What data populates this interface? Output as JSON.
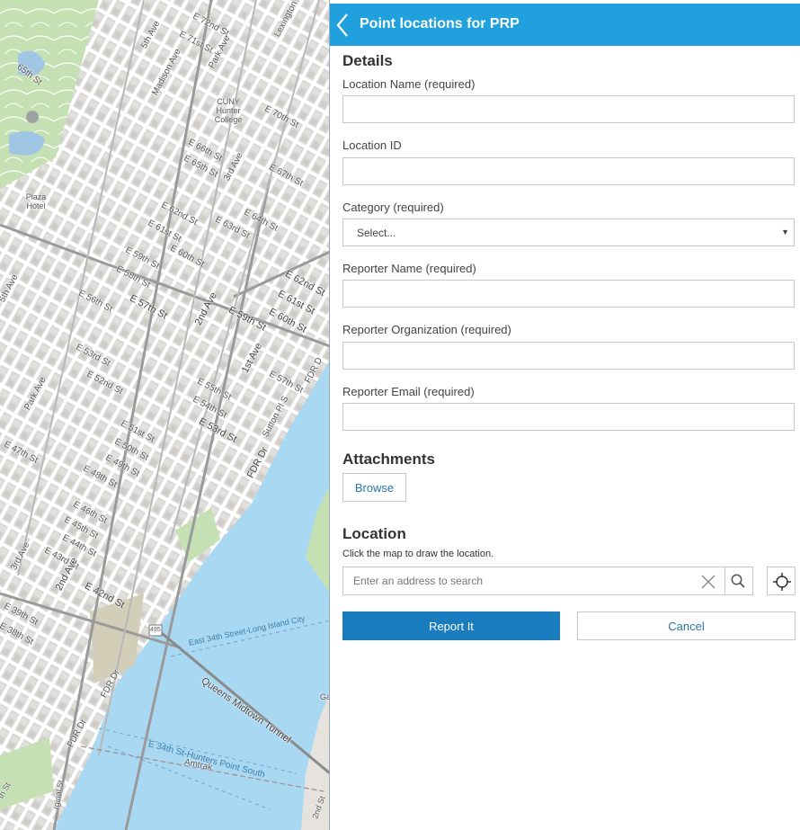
{
  "panel": {
    "title": "Point locations for PRP",
    "details_title": "Details",
    "fields": [
      {
        "label": "Location Name (required)",
        "value": ""
      },
      {
        "label": "Location ID",
        "value": ""
      },
      {
        "label": "Category (required)",
        "value": "Select..."
      },
      {
        "label": "Reporter Name (required)",
        "value": ""
      },
      {
        "label": "Reporter Organization (required)",
        "value": ""
      },
      {
        "label": "Reporter Email (required)",
        "value": ""
      }
    ],
    "attachments_title": "Attachments",
    "browse_label": "Browse",
    "location_title": "Location",
    "location_help": "Click the map to draw the location.",
    "search_placeholder": "Enter an address to search",
    "report_label": "Report It",
    "cancel_label": "Cancel",
    "colors": {
      "header": "#20a0dd",
      "primary_button": "#1a7bbf",
      "link": "#2a74a8"
    }
  },
  "map": {
    "labels": {
      "st65": "65th St",
      "st72": "E 72nd St",
      "st71": "E 71st St",
      "fifth_ave_n": "5th Ave",
      "madison": "Madison Ave",
      "park_ave_n": "Park Ave",
      "lexington": "Lexington",
      "cuny": "CUNY Hunter College",
      "st70": "E 70th St",
      "st66": "E 66th St",
      "st65e": "E 65th St",
      "third_ave_n": "3rd Ave",
      "st67": "E 67th St",
      "plaza": "Plaza Hotel",
      "st62": "E 62nd St",
      "st61": "E 61st St",
      "st63": "E 63rd St",
      "st64": "E 64th St",
      "st60": "E 60th St",
      "st59": "E 59th St",
      "st58": "E 58th St",
      "st56": "E 56th St",
      "st57": "E 57th St",
      "fifth_ave_s": "5th Ave",
      "second_ave_n": "2nd Ave",
      "st59b": "E 59th St",
      "st60b": "E 60th St",
      "st62b": "E 62nd St",
      "st61b": "E 61st St",
      "st53": "E 53rd St",
      "st52": "E 52nd St",
      "park_ave_s": "Park Ave",
      "first_ave": "1st Ave",
      "st55": "E 55th St",
      "st54": "E 54th St",
      "st57b": "E 57th St",
      "fdr": "FDR D",
      "st53b": "E 53rd St",
      "st51": "E 51st St",
      "st50": "E 50th St",
      "sutton": "Sutton Pl S",
      "st47": "E 47th St",
      "st49": "E 49th St",
      "st48": "E 48th St",
      "fdr2": "FDR Dr",
      "st46": "E 46th St",
      "st45": "E 45th St",
      "st44": "E 44th St",
      "st43": "E 43rd St",
      "third_ave_s": "3rd Ave",
      "second_ave_s": "2nd Ave",
      "st42": "E 42nd St",
      "st39": "E 39th St",
      "st38": "E 38th St",
      "ferry": "East 34th Street-Long Island City",
      "route": "495",
      "tunnel": "Queens Midtown Tunnel",
      "fdr3": "FDR Dr",
      "fdr4": "FDR Dr",
      "hunters": "E 34th St-Hunters Point South",
      "amtrak": "Amtrak",
      "ga": "Ga",
      "bottom1": "2nd St",
      "bottom2": "rginal St",
      "bottom3": "th St"
    }
  }
}
